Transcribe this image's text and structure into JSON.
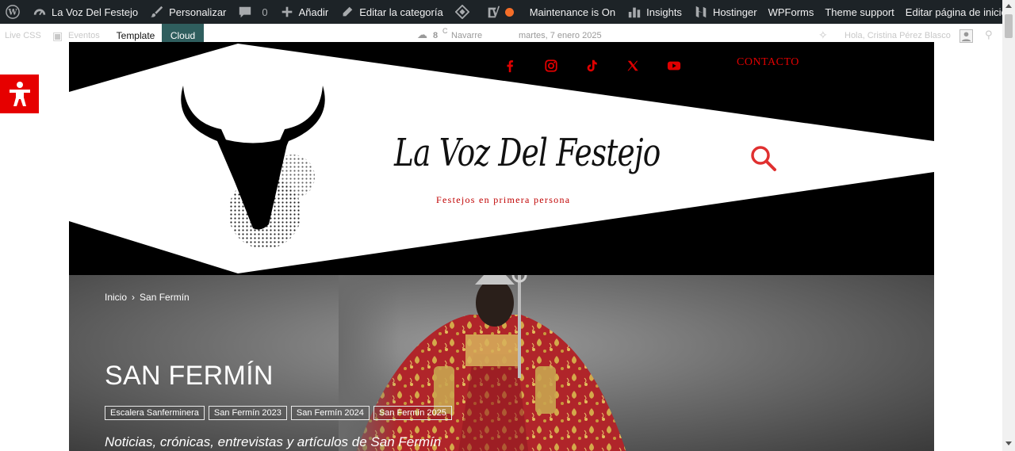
{
  "admin_bar": {
    "site_name": "La Voz Del Festejo",
    "customize": "Personalizar",
    "comments_count": "0",
    "add_new": "Añadir",
    "edit_category": "Editar la categoría",
    "maintenance": "Maintenance is On",
    "insights": "Insights",
    "hostinger": "Hostinger",
    "wpforms": "WPForms",
    "theme_support": "Theme support",
    "edit_home": "Editar página de inicio",
    "accent_orange": "#f56e28"
  },
  "sub_bar": {
    "live_css": "Live CSS",
    "eventos": "Eventos",
    "tab_template": "Template",
    "tab_cloud": "Cloud",
    "weather_temp": "8",
    "weather_unit": "C",
    "weather_location": "Navarre",
    "date": "martes, 7 enero 2025",
    "greeting": "Hola, Cristina Pérez Blasco"
  },
  "header": {
    "title": "La Voz Del Festejo",
    "tagline": "Festejos en primera persona",
    "contact": "CONTACTO",
    "social": [
      "facebook-icon",
      "instagram-icon",
      "tiktok-icon",
      "x-icon",
      "youtube-icon"
    ],
    "accent_red": "#e00000"
  },
  "hero": {
    "breadcrumb_home": "Inicio",
    "breadcrumb_sep": "›",
    "breadcrumb_current": "San Fermín",
    "title": "SAN FERMÍN",
    "tags": [
      "Escalera Sanferminera",
      "San Fermín 2023",
      "San Fermín 2024",
      "San Fermín 2025"
    ],
    "subtitle": "Noticias, crónicas, entrevistas y artículos de San Fermín"
  }
}
